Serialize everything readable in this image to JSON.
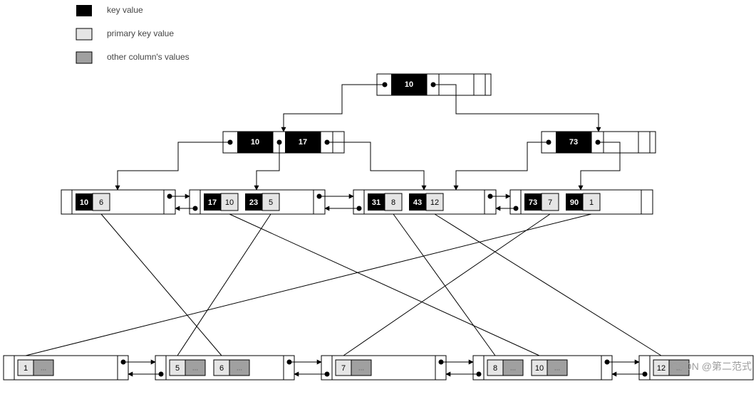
{
  "legend": {
    "keyvalue": "key value",
    "primarykey": "primary key value",
    "othercol": "other column's values"
  },
  "root": {
    "keys": [
      "10"
    ]
  },
  "internal": [
    {
      "id": "L",
      "keys": [
        "10",
        "17"
      ]
    },
    {
      "id": "R",
      "keys": [
        "73"
      ]
    }
  ],
  "secondary_leaves": [
    {
      "id": "S0",
      "pairs": [
        [
          "10",
          "6"
        ]
      ]
    },
    {
      "id": "S1",
      "pairs": [
        [
          "17",
          "10"
        ],
        [
          "23",
          "5"
        ]
      ]
    },
    {
      "id": "S2",
      "pairs": [
        [
          "31",
          "8"
        ],
        [
          "43",
          "12"
        ]
      ]
    },
    {
      "id": "S3",
      "pairs": [
        [
          "73",
          "7"
        ],
        [
          "90",
          "1"
        ]
      ]
    }
  ],
  "primary_leaves": [
    {
      "id": "P0",
      "cells": [
        [
          "1",
          "..."
        ]
      ]
    },
    {
      "id": "P1",
      "cells": [
        [
          "5",
          "..."
        ],
        [
          "6",
          "..."
        ]
      ]
    },
    {
      "id": "P2",
      "cells": [
        [
          "7",
          "..."
        ]
      ]
    },
    {
      "id": "P3",
      "cells": [
        [
          "8",
          "..."
        ],
        [
          "10",
          "..."
        ]
      ]
    },
    {
      "id": "P4",
      "cells": [
        [
          "12",
          "..."
        ]
      ]
    }
  ],
  "watermark": "CSDN @第二范式"
}
